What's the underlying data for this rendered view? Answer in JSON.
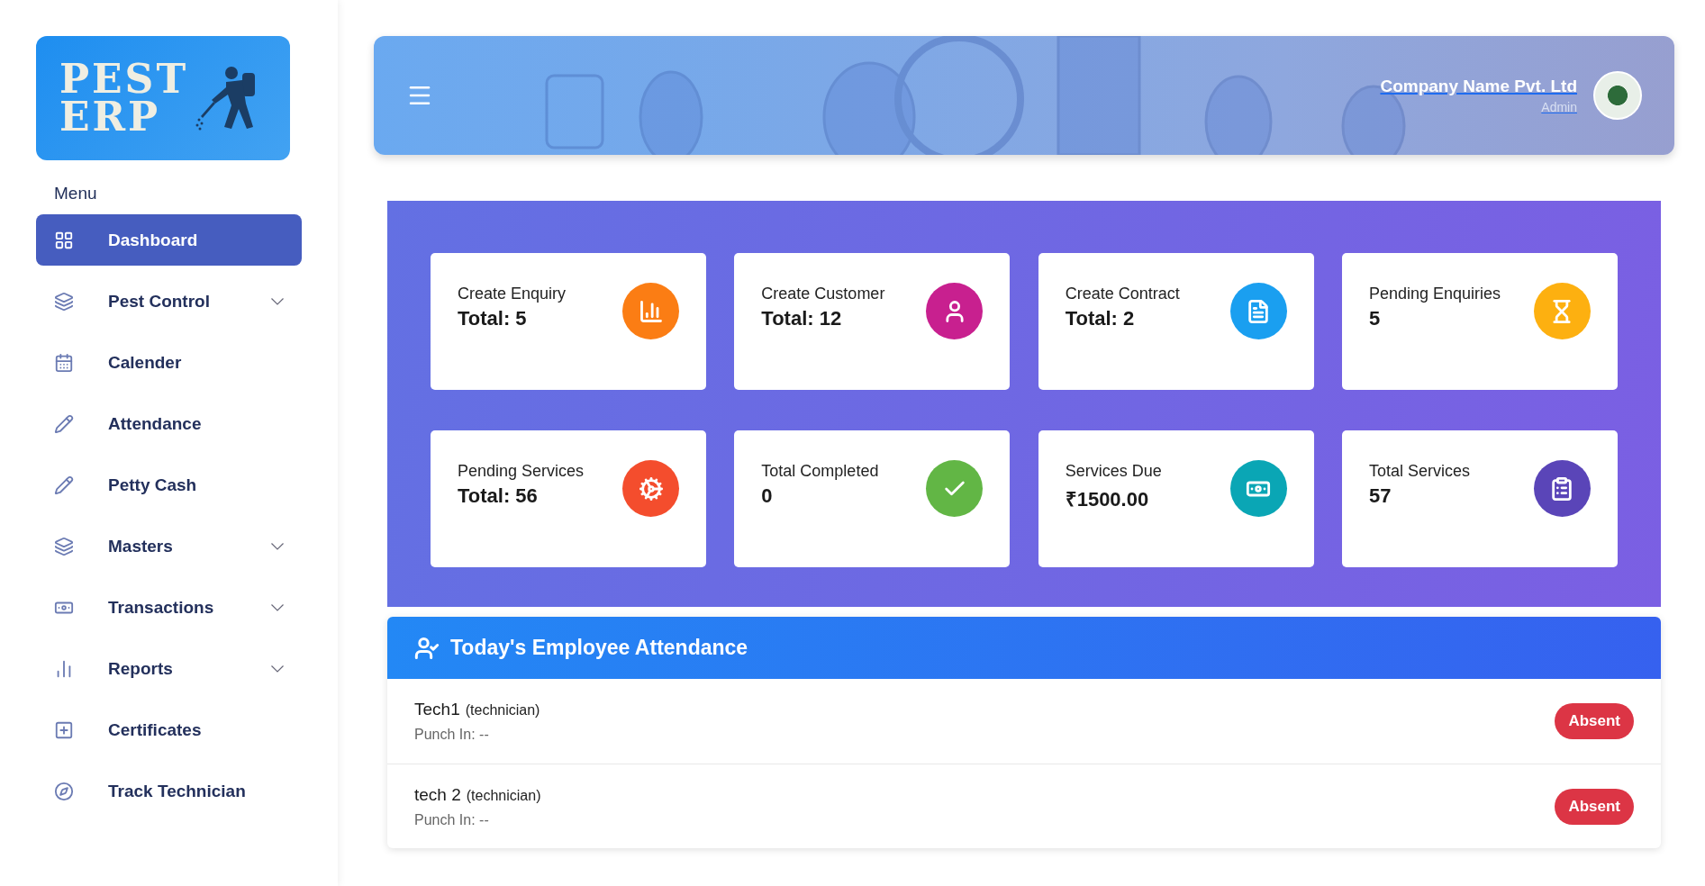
{
  "logo": {
    "line_1": "PEST",
    "line_2": "ERP"
  },
  "sidebar": {
    "heading": "Menu",
    "items": [
      {
        "label": "Dashboard",
        "selected": true,
        "has_submenu": false
      },
      {
        "label": "Pest Control",
        "selected": false,
        "has_submenu": true
      },
      {
        "label": "Calender",
        "selected": false,
        "has_submenu": false
      },
      {
        "label": "Attendance",
        "selected": false,
        "has_submenu": false
      },
      {
        "label": "Petty Cash",
        "selected": false,
        "has_submenu": false
      },
      {
        "label": "Masters",
        "selected": false,
        "has_submenu": true
      },
      {
        "label": "Transactions",
        "selected": false,
        "has_submenu": true
      },
      {
        "label": "Reports",
        "selected": false,
        "has_submenu": true
      },
      {
        "label": "Certificates",
        "selected": false,
        "has_submenu": false
      },
      {
        "label": "Track Technician",
        "selected": false,
        "has_submenu": false
      }
    ]
  },
  "header": {
    "company": "Company Name Pvt. Ltd",
    "role": "Admin"
  },
  "stats": [
    {
      "title": "Create Enquiry",
      "value": "Total: 5",
      "color": "#fb7d14"
    },
    {
      "title": "Create Customer",
      "value": "Total: 12",
      "color": "#c8208f"
    },
    {
      "title": "Create Contract",
      "value": "Total: 2",
      "color": "#1a9ff0"
    },
    {
      "title": "Pending Enquiries",
      "value": "5",
      "color": "#fdb010"
    },
    {
      "title": "Pending Services",
      "value": "Total: 56",
      "color": "#f44d2d"
    },
    {
      "title": "Total Completed",
      "value": "0",
      "color": "#62b645"
    },
    {
      "title": "Services Due",
      "value": "₹1500.00",
      "color": "#0aa6b5"
    },
    {
      "title": "Total Services",
      "value": "57",
      "color": "#5a45b8"
    }
  ],
  "attendance": {
    "title": "Today's Employee Attendance",
    "rows": [
      {
        "name": "Tech1",
        "role": "(technician)",
        "punch": "Punch In: --",
        "status": "Absent"
      },
      {
        "name": "tech 2",
        "role": "(technician)",
        "punch": "Punch In: --",
        "status": "Absent"
      }
    ]
  }
}
